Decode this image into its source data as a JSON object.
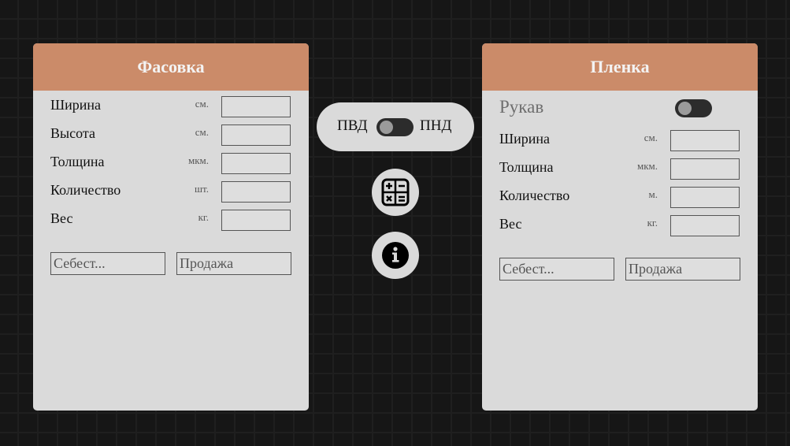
{
  "left_panel": {
    "title": "Фасовка",
    "fields": [
      {
        "label": "Ширина",
        "unit": "см.",
        "value": ""
      },
      {
        "label": "Высота",
        "unit": "см.",
        "value": ""
      },
      {
        "label": "Толщина",
        "unit": "мкм.",
        "value": ""
      },
      {
        "label": "Количество",
        "unit": "шт.",
        "value": ""
      },
      {
        "label": "Вес",
        "unit": "кг.",
        "value": ""
      }
    ],
    "cost_placeholder": "Себест...",
    "sale_placeholder": "Продажа"
  },
  "right_panel": {
    "title": "Пленка",
    "sleeve_label": "Рукав",
    "sleeve_toggle_on": false,
    "fields": [
      {
        "label": "Ширина",
        "unit": "см.",
        "value": ""
      },
      {
        "label": "Толщина",
        "unit": "мкм.",
        "value": ""
      },
      {
        "label": "Количество",
        "unit": "м.",
        "value": ""
      },
      {
        "label": "Вес",
        "unit": "кг.",
        "value": ""
      }
    ],
    "cost_placeholder": "Себест...",
    "sale_placeholder": "Продажа"
  },
  "material_switch": {
    "left_label": "ПВД",
    "right_label": "ПНД",
    "state": "ПВД"
  },
  "actions": {
    "calculator_icon": "calculator-icon",
    "info_icon": "info-icon"
  },
  "colors": {
    "accent": "#cb8b69",
    "panel_bg": "#dadada",
    "page_bg": "#161616"
  }
}
